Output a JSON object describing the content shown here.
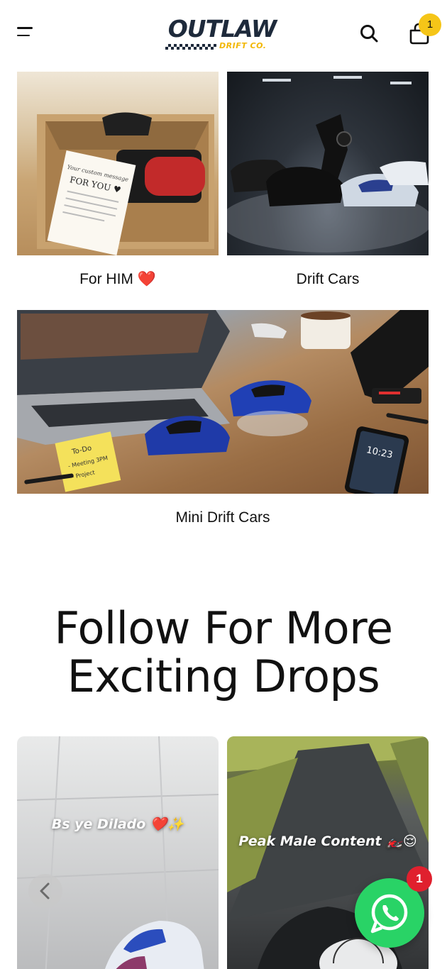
{
  "header": {
    "logo_brand": "OUTLAW",
    "logo_sub": "DRIFT CO.",
    "cart_count": "1"
  },
  "collections": [
    {
      "caption": "For HIM ❤️"
    },
    {
      "caption": "Drift Cars"
    },
    {
      "caption": "Mini Drift Cars"
    }
  ],
  "images": {
    "note_line1": "Your custom message",
    "note_line2": "FOR YOU ♥",
    "sticky_line1": "To-Do",
    "sticky_line2": "- Meeting 3PM",
    "sticky_line3": "- Project",
    "phone_time": "10:23"
  },
  "social": {
    "title_line1": "Follow For More",
    "title_line2": "Exciting Drops",
    "reels": [
      {
        "overlay": "Bs ye Dilado ❤️✨"
      },
      {
        "overlay": "Peak Male Content 🏍️😌"
      }
    ]
  },
  "whatsapp": {
    "badge": "1"
  },
  "colors": {
    "accent": "#f5c518",
    "whatsapp": "#29d366",
    "badge": "#e0202e",
    "text": "#111111"
  }
}
